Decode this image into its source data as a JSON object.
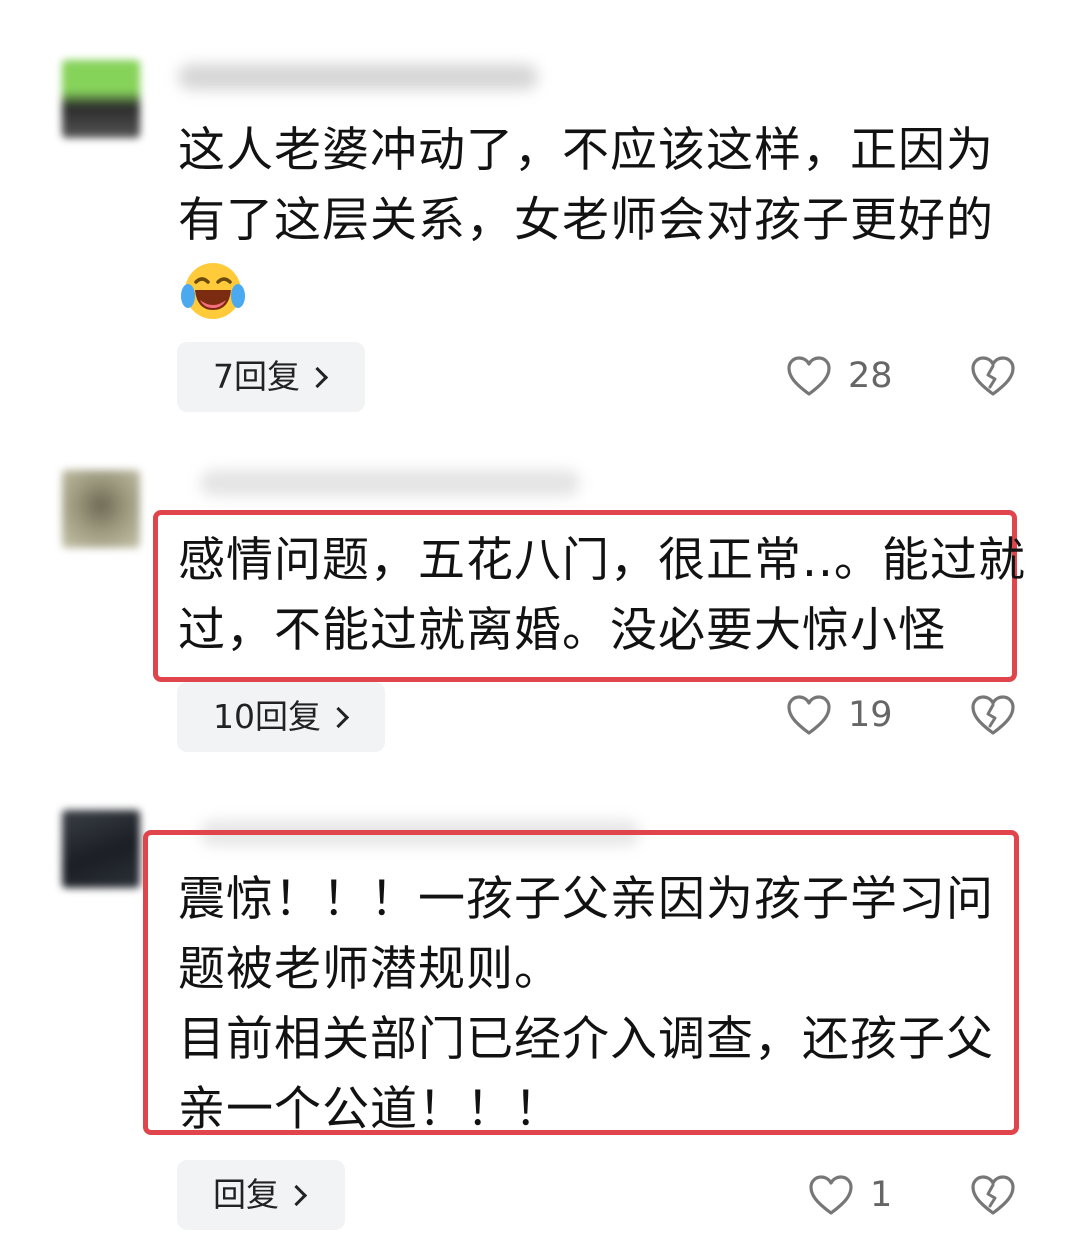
{
  "comments": [
    {
      "lines": [
        "这人老婆冲动了，不应该这样，正因为",
        "有了这层关系，女老师会对孩子更好的"
      ],
      "emoji": "laugh-cry-emoji",
      "reply_label": "7回复",
      "likes": "28"
    },
    {
      "lines": [
        "感情问题，五花八门，很正常..。能过就",
        "过，不能过就离婚。没必要大惊小怪"
      ],
      "reply_label": "10回复",
      "likes": "19"
    },
    {
      "lines": [
        "震惊！！！一孩子父亲因为孩子学习问",
        "题被老师潜规则。",
        "目前相关部门已经介入调查，还孩子父",
        "亲一个公道！！！"
      ],
      "reply_label": "回复",
      "likes": "1"
    }
  ],
  "colors": {
    "highlight": "#e0454c",
    "reply_bg": "#f2f3f5",
    "icon": "#777777"
  },
  "icons": {
    "like": "heart-icon",
    "dislike": "broken-heart-icon",
    "chevron": "chevron-right-icon"
  }
}
